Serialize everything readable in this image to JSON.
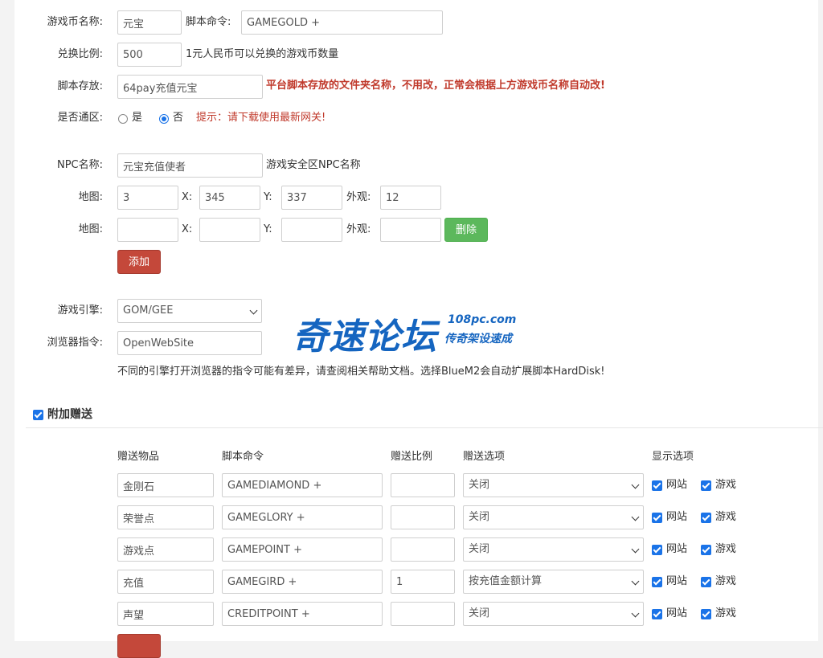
{
  "currency": {
    "name_label": "游戏币名称:",
    "name_value": "元宝",
    "cmd_label": "脚本命令:",
    "cmd_value": "GAMEGOLD +",
    "ratio_label": "兑换比例:",
    "ratio_value": "500",
    "ratio_hint": "1元人民币可以兑换的游戏币数量",
    "storage_label": "脚本存放:",
    "storage_value": "64pay充值元宝",
    "storage_hint": "平台脚本存放的文件夹名称，不用改，正常会根据上方游戏币名称自动改!",
    "common_label": "是否通区:",
    "opt_yes": "是",
    "opt_no": "否",
    "common_selected": "否",
    "common_hint": "提示：请下载使用最新网关!"
  },
  "npc": {
    "name_label": "NPC名称:",
    "name_value": "元宝充值使者",
    "name_hint": "游戏安全区NPC名称",
    "map_label": "地图:",
    "x_label": "X:",
    "y_label": "Y:",
    "look_label": "外观:",
    "rows": [
      {
        "map": "3",
        "x": "345",
        "y": "337",
        "look": "12"
      },
      {
        "map": "",
        "x": "",
        "y": "",
        "look": ""
      }
    ],
    "delete_label": "删除",
    "add_label": "添加"
  },
  "engine": {
    "label": "游戏引擎:",
    "value": "GOM/GEE",
    "browser_label": "浏览器指令:",
    "browser_value": "OpenWebSite",
    "note": "不同的引擎打开浏览器的指令可能有差异，请查阅相关帮助文档。选择BlueM2会自动扩展脚本HardDisk!"
  },
  "watermark": {
    "main": "奇速论坛",
    "site": "108pc.com",
    "slogan": "传奇架设速成"
  },
  "bonus": {
    "title": "附加赠送",
    "checked": true,
    "headers": [
      "赠送物品",
      "脚本命令",
      "赠送比例",
      "赠送选项",
      "显示选项"
    ],
    "site_label": "网站",
    "game_label": "游戏",
    "rows": [
      {
        "item": "金刚石",
        "cmd": "GAMEDIAMOND +",
        "ratio": "",
        "option": "关闭"
      },
      {
        "item": "荣誉点",
        "cmd": "GAMEGLORY +",
        "ratio": "",
        "option": "关闭"
      },
      {
        "item": "游戏点",
        "cmd": "GAMEPOINT +",
        "ratio": "",
        "option": "关闭"
      },
      {
        "item": "充值",
        "cmd": "GAMEGIRD +",
        "ratio": "1",
        "option": "按充值金额计算"
      },
      {
        "item": "声望",
        "cmd": "CREDITPOINT +",
        "ratio": "",
        "option": "关闭"
      }
    ]
  },
  "colors": {
    "accent": "#1a73e8",
    "red_button": "#c4483a",
    "green_button": "#5cb85c",
    "warning": "#c0392b"
  }
}
